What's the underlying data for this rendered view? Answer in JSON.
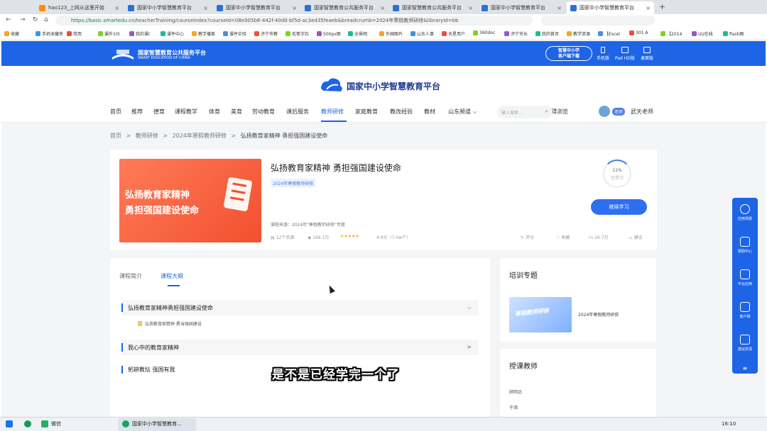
{
  "browser": {
    "tabs": [
      {
        "label": "hao123_上网从这里开始"
      },
      {
        "label": "国家中小学智慧教育平台"
      },
      {
        "label": "国家中小学智慧教育平台"
      },
      {
        "label": "国家智慧教育公共服务平台"
      },
      {
        "label": "国家智慧教育公共服务平台"
      },
      {
        "label": "国家中小学智慧教育平台"
      },
      {
        "label": "国家中小学智慧教育平台"
      }
    ],
    "new_tab": "+",
    "url_host": "https://basic.smartedu.cn",
    "url_path": "/teacherTraining/courseIndex?courseId=08e005b6-442f-40d0-bf5d-ac3ed35feaeb&breadcrumb=2024年寒假教师研修&libraryId=bb",
    "bookmarks": [
      "收藏",
      "手机收藏夹",
      "常用",
      "课外10(",
      "我的课(",
      "课件中心",
      "教学播客",
      "课件实验",
      "济宁市教",
      "毛笔字石",
      "500px图",
      "全景网",
      "外国图片",
      "山东人事",
      "天星用户",
      "360doc",
      "济宁市长",
      "我的首页",
      "教学资源",
      "【Excel",
      "301 A",
      "【2014",
      "UU在线",
      "flash图"
    ]
  },
  "site": {
    "header_name": "国家智慧教育公共服务平台",
    "header_name_en": "SMART EDUCATION OF CHINA",
    "download_line1": "智慧中小学",
    "download_line2": "客户端下载",
    "devices": [
      "手机版",
      "Pad HD版",
      "桌面版"
    ],
    "platform_name": "国家中小学智慧教育平台",
    "nav": [
      "首页",
      "推荐",
      "德育",
      "课程教学",
      "体育",
      "美育",
      "劳动教育",
      "课后服务",
      "教师研修",
      "家庭教育",
      "教改经验",
      "教材",
      "山东频道"
    ],
    "nav_dropdown": "⌵",
    "search_placeholder": "输入搜索...",
    "accessible": "无障碍浏览",
    "role_badge": "老师",
    "user_name": "武天老师"
  },
  "breadcrumb": [
    "首页",
    "教师研修",
    "2024年寒假教师研修",
    "弘扬教育家精神 勇担强国建设使命"
  ],
  "breadcrumb_sep": ">",
  "course": {
    "banner_line1": "弘扬教育家精神",
    "banner_line2": "勇担强国建设使命",
    "title": "弘扬教育家精神 勇担强国建设使命",
    "tag": "2024年寒假教师研修",
    "progress": "11%",
    "progress_fraction": 0.11,
    "progress_label": "已学习",
    "continue_button": "继续学习",
    "source": "课程来源：2024年\"寒假教师研修\"专题",
    "resources": "12个资源",
    "views": "168.1万",
    "stars": "★★★★★",
    "rating": "4.9分（7.0w个）",
    "actions": [
      "评分",
      "收藏",
      "26.7万",
      "建议"
    ]
  },
  "tabs": [
    "课程简介",
    "课程大纲"
  ],
  "outline": {
    "sections": [
      "弘扬教育家精神勇担强国建设使命",
      "我心中的教育家精神",
      "躬耕教坛 强国有我"
    ],
    "sub_item": "弘扬教育家精神 勇当强国建设",
    "chev_open": "⌵",
    "chev_closed": ">"
  },
  "training": {
    "title": "培训专题",
    "thumb_text": "寒假教师研修",
    "item": "2024年寒假教师研修"
  },
  "teachers": {
    "title": "授课教师",
    "names": [
      "顾明远",
      "于漪"
    ]
  },
  "floatbar": [
    "应用场景",
    "帮助中心",
    "平台应用",
    "客户端",
    "建议反馈"
  ],
  "floatbar_more": "≡",
  "subtitle": "是不是已经学完一个了",
  "taskbar": {
    "wechat": "微信",
    "active_window": "国家中小学智慧教育...",
    "time": "16:10"
  }
}
